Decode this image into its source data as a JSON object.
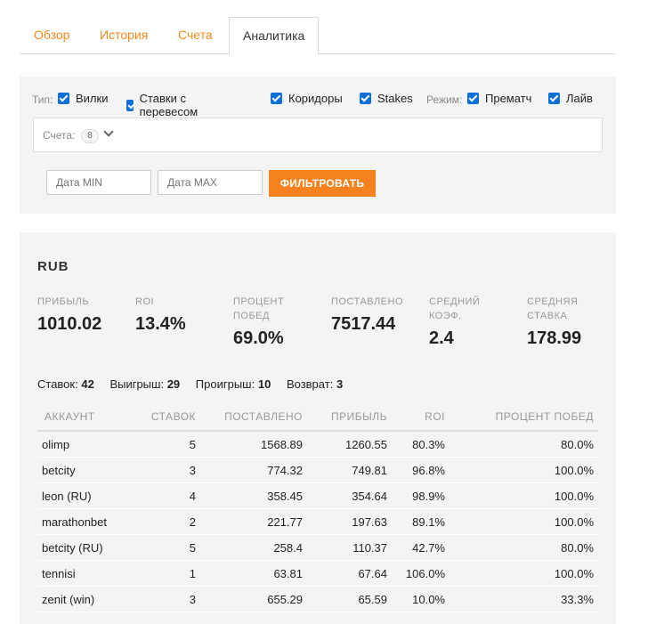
{
  "tabs": [
    "Обзор",
    "История",
    "Счета",
    "Аналитика"
  ],
  "active_tab": "Аналитика",
  "filter": {
    "type_label": "Тип:",
    "types": [
      "Вилки",
      "Ставки с перевесом",
      "Коридоры",
      "Stakes"
    ],
    "mode_label": "Режим:",
    "modes": [
      "Прематч",
      "Лайв"
    ],
    "accounts_label": "Счета:",
    "accounts_count": "8",
    "date_min_placeholder": "Дата MIN",
    "date_max_placeholder": "Дата MAX",
    "filter_button": "ФИЛЬТРОВАТЬ"
  },
  "stats": {
    "currency": "RUB",
    "metrics": [
      {
        "label": "ПРИБЫЛЬ",
        "value": "1010.02"
      },
      {
        "label": "ROI",
        "value": "13.4%"
      },
      {
        "label": "ПРОЦЕНТ ПОБЕД",
        "value": "69.0%"
      },
      {
        "label": "ПОСТАВЛЕНО",
        "value": "7517.44"
      },
      {
        "label": "СРЕДНИЙ КОЭФ.",
        "value": "2.4"
      },
      {
        "label": "СРЕДНЯЯ СТАВКА",
        "value": "178.99"
      }
    ],
    "counts": [
      {
        "label": "Ставок:",
        "value": "42"
      },
      {
        "label": "Выигрыш:",
        "value": "29"
      },
      {
        "label": "Проигрыш:",
        "value": "10"
      },
      {
        "label": "Возврат:",
        "value": "3"
      }
    ],
    "table": {
      "headers": [
        "АККАУНТ",
        "СТАВОК",
        "ПОСТАВЛЕНО",
        "ПРИБЫЛЬ",
        "ROI",
        "ПРОЦЕНТ ПОБЕД"
      ],
      "rows": [
        [
          "olimp",
          "5",
          "1568.89",
          "1260.55",
          "80.3%",
          "80.0%"
        ],
        [
          "betcity",
          "3",
          "774.32",
          "749.81",
          "96.8%",
          "100.0%"
        ],
        [
          "leon (RU)",
          "4",
          "358.45",
          "354.64",
          "98.9%",
          "100.0%"
        ],
        [
          "marathonbet",
          "2",
          "221.77",
          "197.63",
          "89.1%",
          "100.0%"
        ],
        [
          "betcity (RU)",
          "5",
          "258.4",
          "110.37",
          "42.7%",
          "80.0%"
        ],
        [
          "tennisi",
          "1",
          "63.81",
          "67.64",
          "106.0%",
          "100.0%"
        ],
        [
          "zenit (win)",
          "3",
          "655.29",
          "65.59",
          "10.0%",
          "33.3%"
        ]
      ]
    }
  },
  "colors": {
    "accent": "#f5821f",
    "checkbox": "#0b6fd6",
    "panel": "#f4f4f4"
  }
}
